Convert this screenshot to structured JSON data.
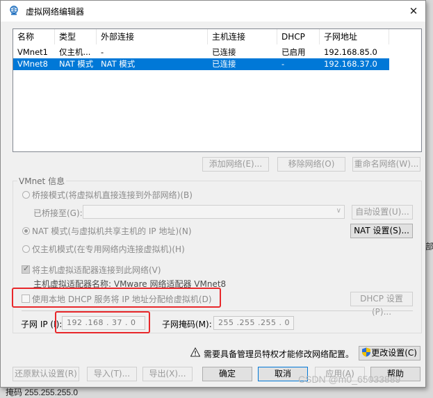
{
  "window": {
    "title": "虚拟网络编辑器"
  },
  "network_table": {
    "columns": [
      "名称",
      "类型",
      "外部连接",
      "主机连接",
      "DHCP",
      "子网地址"
    ],
    "rows": [
      [
        "VMnet1",
        "仅主机...",
        "-",
        "已连接",
        "已启用",
        "192.168.85.0"
      ],
      [
        "VMnet8",
        "NAT 模式",
        "NAT 模式",
        "已连接",
        "-",
        "192.168.37.0"
      ]
    ],
    "selected_index": 1
  },
  "table_buttons": {
    "add": "添加网络(E)...",
    "remove": "移除网络(O)",
    "rename": "重命名网络(W)..."
  },
  "vmnet_info": {
    "group_title": "VMnet 信息",
    "bridged_label": "桥接模式(将虚拟机直接连接到外部网络)(B)",
    "bridged_to_label": "已桥接至(G):",
    "bridged_to_value": "",
    "auto_settings": "自动设置(U)...",
    "nat_label": "NAT 模式(与虚拟机共享主机的 IP 地址)(N)",
    "nat_settings": "NAT 设置(S)...",
    "hostonly_label": "仅主机模式(在专用网络内连接虚拟机)(H)",
    "connect_adapter_label": "将主机虚拟适配器连接到此网络(V)",
    "adapter_name_text": "主机虚拟适配器名称: VMware 网络适配器 VMnet8",
    "dhcp_label": "使用本地 DHCP 服务将 IP 地址分配给虚拟机(D)",
    "dhcp_settings": "DHCP 设置(P)...",
    "subnet_ip_label": "子网 IP (I):",
    "subnet_ip_value": "192 .168 . 37 . 0",
    "subnet_mask_label": "子网掩码(M):",
    "subnet_mask_value": "255 .255 .255 . 0",
    "selected_mode": "nat",
    "connect_adapter_checked": true,
    "dhcp_checked": false
  },
  "admin_notice": {
    "text": "需要具备管理员特权才能修改网络配置。",
    "change_settings": "更改设置(C)"
  },
  "footer_buttons": {
    "restore": "还原默认设置(R)",
    "import": "导入(T)...",
    "export": "导出(X)...",
    "ok": "确定",
    "cancel": "取消",
    "apply": "应用(A)",
    "help": "帮助"
  },
  "watermark": "CSDN @m0_65033889",
  "background_fragments": [
    "设",
    "I",
    "掩码 255.255.255.0",
    "部"
  ],
  "colors": {
    "selection": "#0078d7",
    "highlight_box": "#e8272a"
  }
}
